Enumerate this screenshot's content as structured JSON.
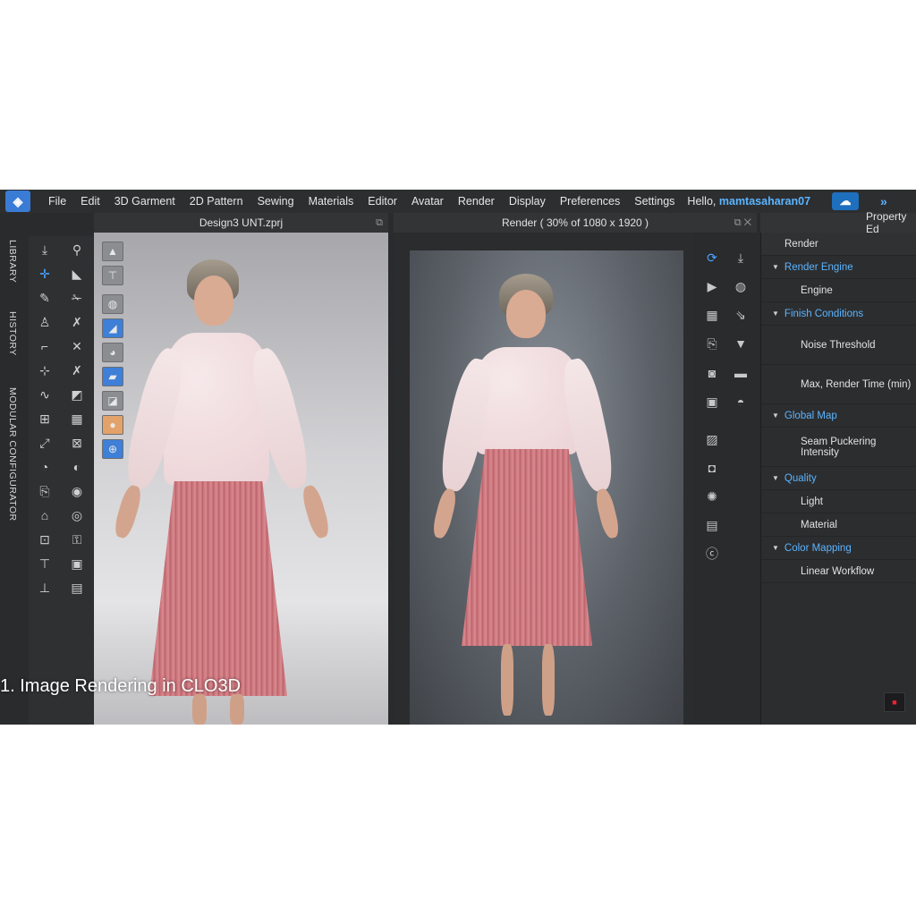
{
  "menubar": {
    "items": [
      "File",
      "Edit",
      "3D Garment",
      "2D Pattern",
      "Sewing",
      "Materials",
      "Editor",
      "Avatar",
      "Render",
      "Display",
      "Preferences",
      "Settings"
    ],
    "hello_prefix": "Hello,",
    "username": "mamtasaharan07"
  },
  "left_tabs": [
    "LIBRARY",
    "HISTORY",
    "MODULAR CONFIGURATOR"
  ],
  "viewport": {
    "title": "Design3 UNT.zprj"
  },
  "render": {
    "title": "Render ( 30% of 1080 x 1920 )"
  },
  "property_editor": {
    "title": "Property Ed",
    "top_item": "Render",
    "rows": [
      {
        "type": "section",
        "label": "Render Engine"
      },
      {
        "type": "item",
        "label": "Engine"
      },
      {
        "type": "section",
        "label": "Finish Conditions"
      },
      {
        "type": "item",
        "label": "Noise Threshold"
      },
      {
        "type": "item",
        "label": "Max, Render Time (min)"
      },
      {
        "type": "section",
        "label": "Global Map"
      },
      {
        "type": "item",
        "label": "Seam Puckering Intensity"
      },
      {
        "type": "section",
        "label": "Quality"
      },
      {
        "type": "item",
        "label": "Light"
      },
      {
        "type": "item",
        "label": "Material"
      },
      {
        "type": "section",
        "label": "Color Mapping"
      },
      {
        "type": "item",
        "label": "Linear Workflow"
      }
    ]
  },
  "caption": "1. Image Rendering in CLO3D",
  "colors": {
    "accent": "#5bb4ff",
    "background": "#2a2b2d",
    "skirt": "#c86f76"
  }
}
